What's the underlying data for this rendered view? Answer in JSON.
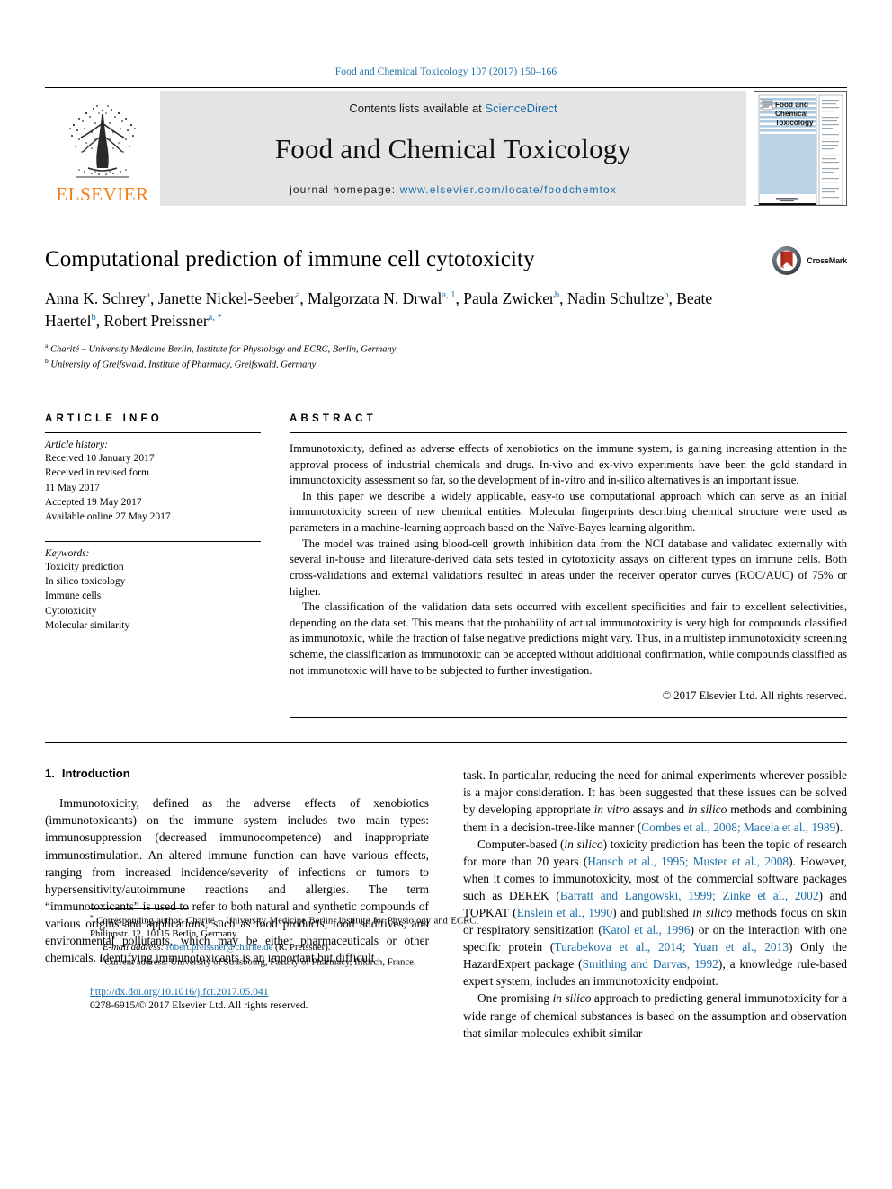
{
  "running_head": "Food and Chemical Toxicology 107 (2017) 150–166",
  "masthead": {
    "publisher_name": "ELSEVIER",
    "contents_prefix": "Contents lists available at ",
    "contents_link": "ScienceDirect",
    "journal_name": "Food and Chemical Toxicology",
    "homepage_prefix": "journal homepage: ",
    "homepage_url": "www.elsevier.com/locate/foodchemtox",
    "cover_title_lines": [
      "Food and",
      "Chemical",
      "Toxicology"
    ]
  },
  "title": "Computational prediction of immune cell cytotoxicity",
  "crossmark_label": "CrossMark",
  "authors": [
    {
      "name": "Anna K. Schrey",
      "marks": "a"
    },
    {
      "name": "Janette Nickel-Seeber",
      "marks": "a"
    },
    {
      "name": "Malgorzata N. Drwal",
      "marks": "a, 1"
    },
    {
      "name": "Paula Zwicker",
      "marks": "b"
    },
    {
      "name": "Nadin Schultze",
      "marks": "b"
    },
    {
      "name": "Beate Haertel",
      "marks": "b"
    },
    {
      "name": "Robert Preissner",
      "marks": "a, *"
    }
  ],
  "affiliations": [
    {
      "mark": "a",
      "text": "Charité – University Medicine Berlin, Institute for Physiology and ECRC, Berlin, Germany"
    },
    {
      "mark": "b",
      "text": "University of Greifswald, Institute of Pharmacy, Greifswald, Germany"
    }
  ],
  "article_info": {
    "heading": "ARTICLE INFO",
    "history_label": "Article history:",
    "history": [
      "Received 10 January 2017",
      "Received in revised form",
      "11 May 2017",
      "Accepted 19 May 2017",
      "Available online 27 May 2017"
    ],
    "keywords_label": "Keywords:",
    "keywords": [
      "Toxicity prediction",
      "In silico toxicology",
      "Immune cells",
      "Cytotoxicity",
      "Molecular similarity"
    ]
  },
  "abstract": {
    "heading": "ABSTRACT",
    "paragraphs": [
      "Immunotoxicity, defined as adverse effects of xenobiotics on the immune system, is gaining increasing attention in the approval process of industrial chemicals and drugs. In-vivo and ex-vivo experiments have been the gold standard in immunotoxicity assessment so far, so the development of in-vitro and in-silico alternatives is an important issue.",
      "In this paper we describe a widely applicable, easy-to use computational approach which can serve as an initial immunotoxicity screen of new chemical entities. Molecular fingerprints describing chemical structure were used as parameters in a machine-learning approach based on the Naïve-Bayes learning algorithm.",
      "The model was trained using blood-cell growth inhibition data from the NCI database and validated externally with several in-house and literature-derived data sets tested in cytotoxicity assays on different types on immune cells. Both cross-validations and external validations resulted in areas under the receiver operator curves (ROC/AUC) of 75% or higher.",
      "The classification of the validation data sets occurred with excellent specificities and fair to excellent selectivities, depending on the data set. This means that the probability of actual immunotoxicity is very high for compounds classified as immunotoxic, while the fraction of false negative predictions might vary. Thus, in a multistep immunotoxicity screening scheme, the classification as immunotoxic can be accepted without additional confirmation, while compounds classified as not immunotoxic will have to be subjected to further investigation."
    ],
    "copyright": "© 2017 Elsevier Ltd. All rights reserved."
  },
  "introduction": {
    "number": "1.",
    "heading": "Introduction",
    "left_paragraph": "Immunotoxicity, defined as the adverse effects of xenobiotics (immunotoxicants) on the immune system includes two main types: immunosuppression (decreased immunocompetence) and inappropriate immunostimulation. An altered immune function can have various effects, ranging from increased incidence/severity of infections or tumors to hypersensitivity/autoimmune reactions and allergies. The term “immunotoxicants” is used to refer to both natural and synthetic compounds of various origins and applications, such as food products, food additives, and environmental pollutants, which may be either pharmaceuticals or other chemicals. Identifying immunotoxicants is an important but difficult",
    "right_p1_a": "task. In particular, reducing the need for animal experiments wherever possible is a major consideration. It has been suggested that these issues can be solved by developing appropriate ",
    "right_p1_ital1": "in vitro",
    "right_p1_b": " assays and ",
    "right_p1_ital2": "in silico",
    "right_p1_c": " methods and combining them in a decision-tree-like manner (",
    "right_p1_cite": "Combes et al., 2008; Macela et al., 1989",
    "right_p1_d": ").",
    "right_p2_a": "Computer-based (",
    "right_p2_ital1": "in silico",
    "right_p2_b": ") toxicity prediction has been the topic of research for more than 20 years (",
    "right_p2_cite1": "Hansch et al., 1995; Muster et al., 2008",
    "right_p2_c": "). However, when it comes to immunotoxicity, most of the commercial software packages such as DEREK (",
    "right_p2_cite2": "Barratt and Langowski, 1999; Zinke et al., 2002",
    "right_p2_d": ") and TOPKAT (",
    "right_p2_cite3": "Enslein et al., 1990",
    "right_p2_e": ") and published ",
    "right_p2_ital2": "in silico",
    "right_p2_f": " methods focus on skin or respiratory sensitization (",
    "right_p2_cite4": "Karol et al., 1996",
    "right_p2_g": ") or on the interaction with one specific protein (",
    "right_p2_cite5": "Turabekova et al., 2014; Yuan et al., 2013",
    "right_p2_h": ") Only the HazardExpert package (",
    "right_p2_cite6": "Smithing and Darvas, 1992",
    "right_p2_i": "), a knowledge rule-based expert system, includes an immunotoxicity endpoint.",
    "right_p3_a": "One promising ",
    "right_p3_ital1": "in silico",
    "right_p3_b": " approach to predicting general immunotoxicity for a wide range of chemical substances is based on the assumption and observation that similar molecules exhibit similar"
  },
  "footnotes": {
    "corresponding_mark": "*",
    "corresponding_text": " Corresponding author. Charité – University Medicine Berlin, Institute for Physiology and ECRC, Philippstr. 12, 10115 Berlin, Germany.",
    "email_label": "E-mail address:",
    "email_value": "robert.preissner@charite.de",
    "email_owner": "(R. Preissner).",
    "current_address_mark": "1",
    "current_address_text": " Current address: University of Strasbourg, Faculty of Pharmacy, Illkirch, France."
  },
  "footer": {
    "doi": "http://dx.doi.org/10.1016/j.fct.2017.05.041",
    "issn_line": "0278-6915/© 2017 Elsevier Ltd. All rights reserved."
  },
  "colors": {
    "link_blue": "#1a6fa8",
    "elsevier_orange": "#f07f18",
    "masthead_gray": "#e4e4e4",
    "crossmark_red": "#b83020"
  }
}
